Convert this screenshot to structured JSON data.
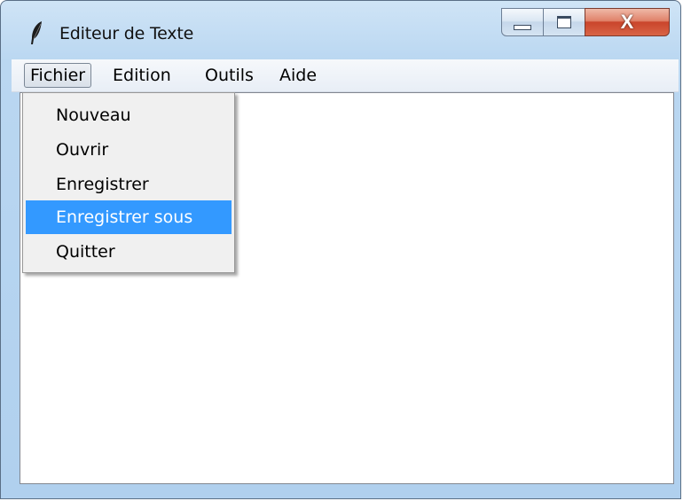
{
  "window": {
    "title": "Editeur de Texte"
  },
  "title_buttons": {
    "close_glyph": "X"
  },
  "menubar": {
    "items": [
      {
        "label": "Fichier",
        "active": true
      },
      {
        "label": "Edition"
      },
      {
        "label": "Outils"
      },
      {
        "label": "Aide"
      }
    ]
  },
  "file_menu": {
    "items": [
      {
        "label": "Nouveau"
      },
      {
        "label": "Ouvrir"
      },
      {
        "label": "Enregistrer"
      },
      {
        "label": "Enregistrer sous",
        "highlighted": true
      },
      {
        "label": "Quitter"
      }
    ]
  },
  "colors": {
    "highlight": "#3399ff",
    "menu_bg": "#f0f0f0"
  },
  "icons": {
    "app": "feather-icon"
  }
}
